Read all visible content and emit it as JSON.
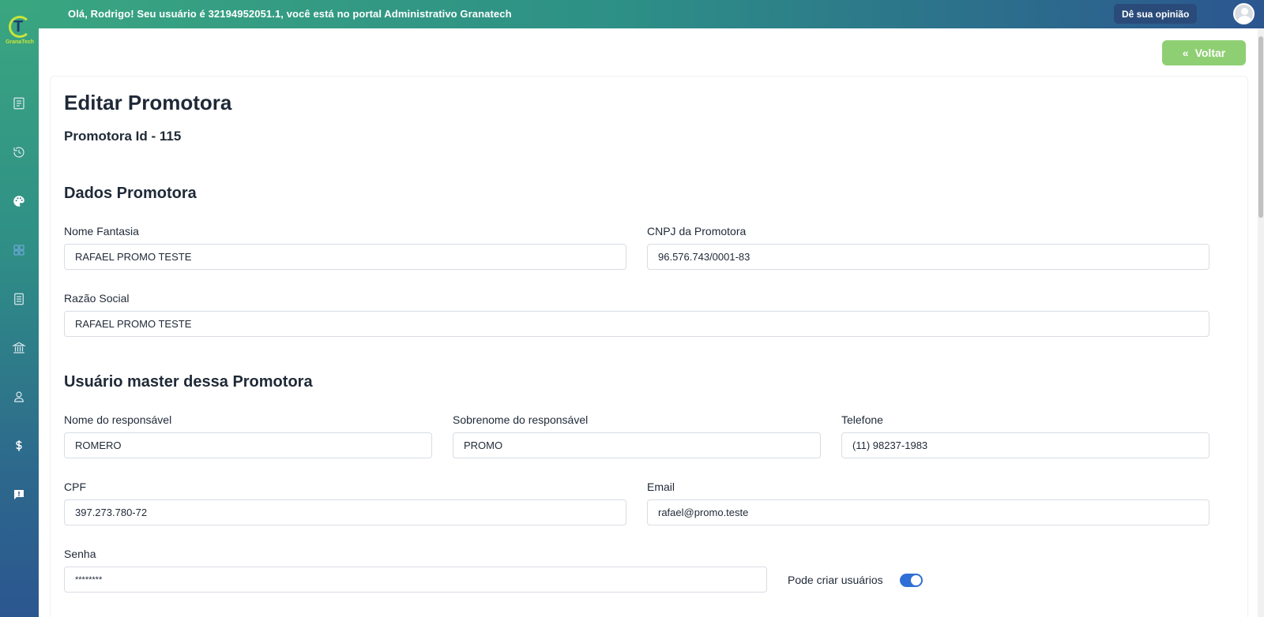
{
  "header": {
    "welcome": "Olá, Rodrigo! Seu usuário é 32194952051.1, você está no portal Administrativo Granatech",
    "feedback_label": "Dê sua opinião",
    "logo_text": "GranaTech"
  },
  "sidebar": {
    "icons": [
      "document-icon",
      "history-icon",
      "palette-icon",
      "grid-icon",
      "receipt-icon",
      "bank-icon",
      "user-icon",
      "dollar-icon",
      "feedback-icon"
    ]
  },
  "toolbar": {
    "back_label": "Voltar"
  },
  "page": {
    "title": "Editar Promotora",
    "subtitle": "Promotora Id - 115"
  },
  "sections": {
    "dados": "Dados Promotora",
    "usuario": "Usuário master dessa Promotora"
  },
  "form": {
    "nome_fantasia": {
      "label": "Nome Fantasia",
      "value": "RAFAEL PROMO TESTE"
    },
    "cnpj": {
      "label": "CNPJ da Promotora",
      "value": "96.576.743/0001-83"
    },
    "razao_social": {
      "label": "Razão Social",
      "value": "RAFAEL PROMO TESTE"
    },
    "nome_responsavel": {
      "label": "Nome do responsável",
      "value": "ROMERO"
    },
    "sobrenome_responsavel": {
      "label": "Sobrenome do responsável",
      "value": "PROMO"
    },
    "telefone": {
      "label": "Telefone",
      "value": "(11) 98237-1983"
    },
    "cpf": {
      "label": "CPF",
      "value": "397.273.780-72"
    },
    "email": {
      "label": "Email",
      "value": "rafael@promo.teste"
    },
    "senha": {
      "label": "Senha",
      "value": "********"
    },
    "pode_criar": {
      "label": "Pode criar usuários",
      "checked": true
    }
  },
  "colors": {
    "accent_green": "#8fcf74",
    "toggle_blue": "#2f6fd6",
    "feedback_bg": "#2a4b7a"
  }
}
